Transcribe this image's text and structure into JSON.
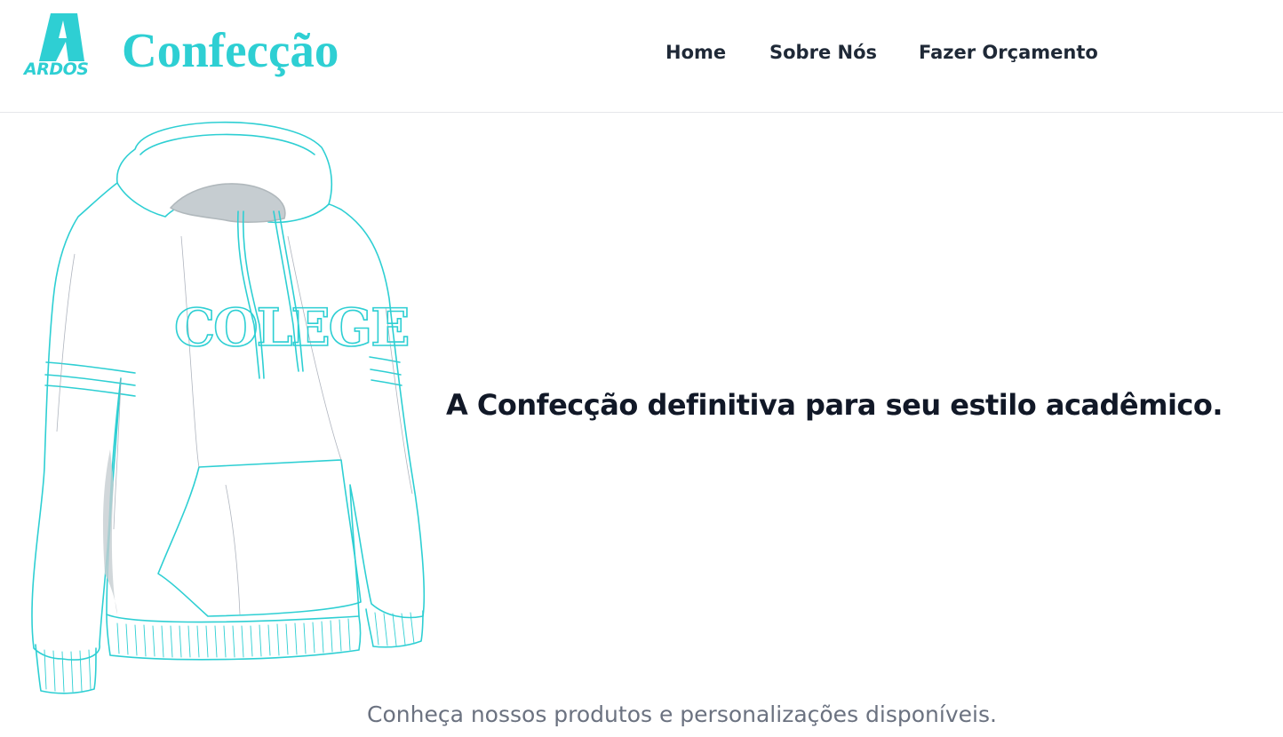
{
  "brand": {
    "logo_text": "ARDOS",
    "name": "Confecção",
    "accent_color": "#2ecfd3"
  },
  "nav": {
    "items": [
      {
        "label": "Home"
      },
      {
        "label": "Sobre Nós"
      },
      {
        "label": "Fazer Orçamento"
      }
    ]
  },
  "hero": {
    "illustration_text": "COLEGE",
    "illustration_icon": "hoodie-illustration",
    "headline": "A Confecção definitiva para seu estilo acadêmico.",
    "subline": "Conheça nossos produtos e personalizações disponíveis."
  }
}
